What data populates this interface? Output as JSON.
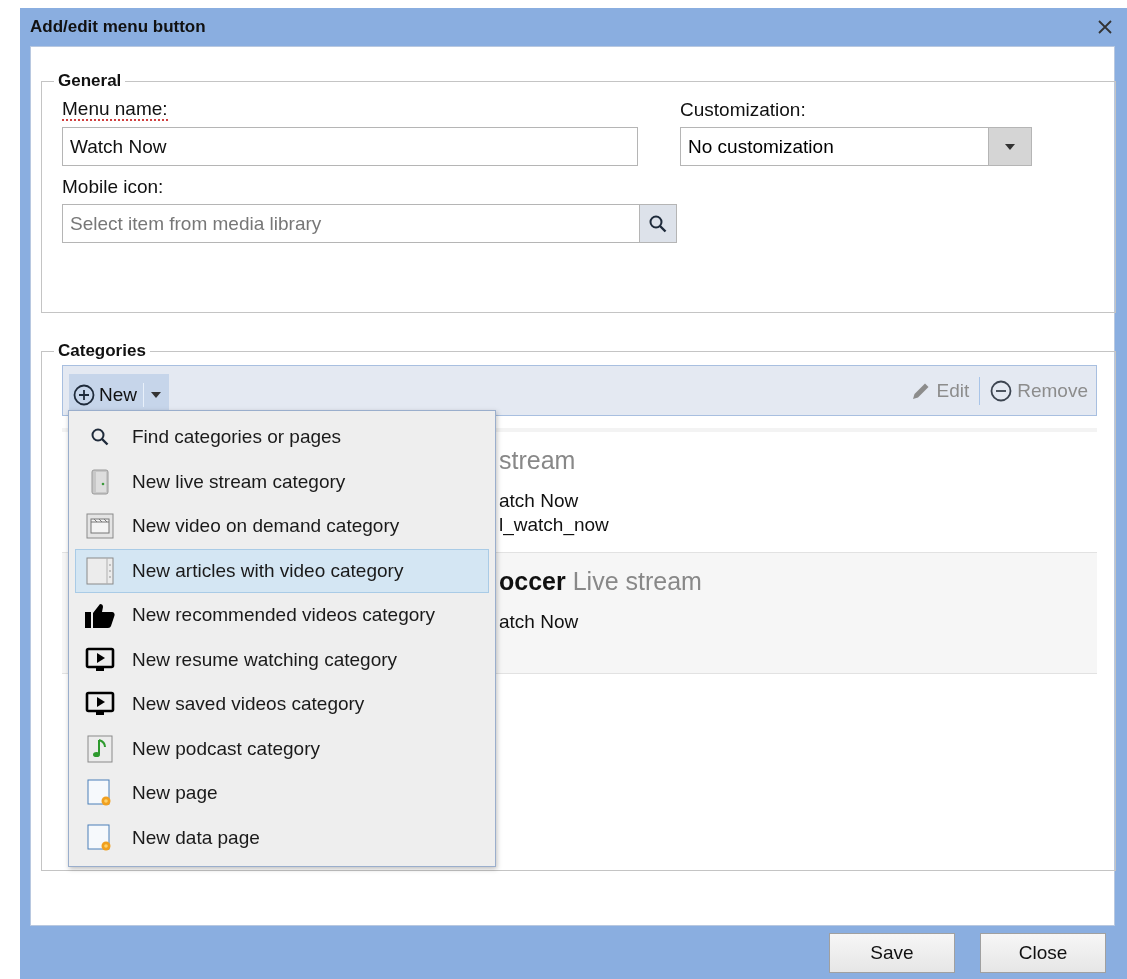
{
  "dialog": {
    "title": "Add/edit menu button"
  },
  "general": {
    "legend": "General",
    "menu_name": {
      "label": "Menu name:",
      "value": "Watch Now"
    },
    "customization": {
      "label": "Customization:",
      "value": "No customization"
    },
    "mobile_icon": {
      "label": "Mobile icon:",
      "placeholder": "Select item from media library"
    }
  },
  "categories": {
    "legend": "Categories",
    "toolbar": {
      "new": "New",
      "edit": {
        "label": "Edit",
        "disabled": true
      },
      "remove": {
        "label": "Remove",
        "disabled": true
      }
    },
    "rows": [
      {
        "name": "",
        "type_label": "stream",
        "lines": [
          "atch Now",
          "l_watch_now"
        ]
      },
      {
        "name": "occer",
        "type_label": "Live stream",
        "lines": [
          "atch Now"
        ]
      }
    ],
    "menu": {
      "items": [
        {
          "kind": "search",
          "label": "Find categories or pages",
          "selected": false
        },
        {
          "kind": "server",
          "label": "New live stream category",
          "selected": false
        },
        {
          "kind": "clapper",
          "label": "New video on demand category",
          "selected": false
        },
        {
          "kind": "strip",
          "label": "New articles with video category",
          "selected": true
        },
        {
          "kind": "thumb",
          "label": "New recommended videos category",
          "selected": false
        },
        {
          "kind": "screen",
          "label": "New resume watching category",
          "selected": false
        },
        {
          "kind": "screen",
          "label": "New saved videos category",
          "selected": false
        },
        {
          "kind": "music",
          "label": "New podcast category",
          "selected": false
        },
        {
          "kind": "page",
          "label": "New page",
          "selected": false
        },
        {
          "kind": "page",
          "label": "New data page",
          "selected": false
        }
      ]
    }
  },
  "buttons": [
    "Save",
    "Close"
  ]
}
